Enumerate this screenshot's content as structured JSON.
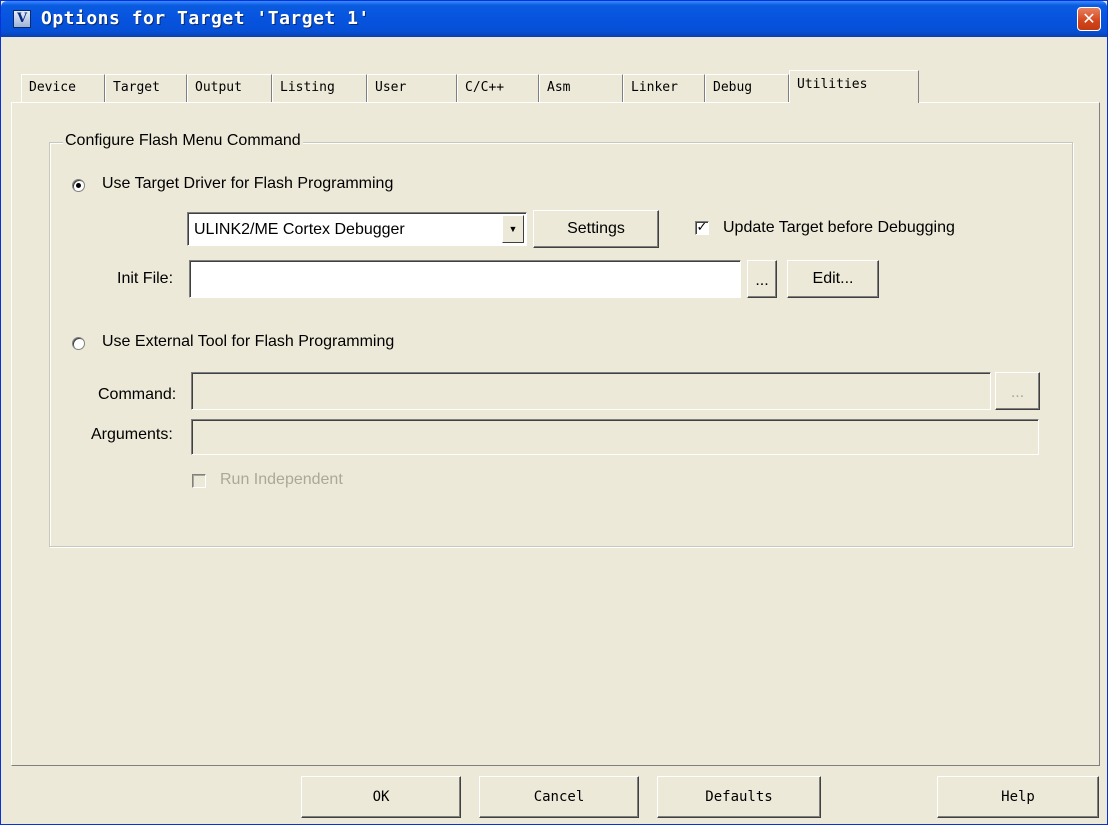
{
  "window": {
    "title": "Options for Target 'Target 1'",
    "app_icon": "V",
    "close_glyph": "✕"
  },
  "tabs": [
    {
      "label": "Device"
    },
    {
      "label": "Target"
    },
    {
      "label": "Output"
    },
    {
      "label": "Listing"
    },
    {
      "label": "User"
    },
    {
      "label": "C/C++"
    },
    {
      "label": "Asm"
    },
    {
      "label": "Linker"
    },
    {
      "label": "Debug"
    },
    {
      "label": "Utilities",
      "active": true
    }
  ],
  "flash_group": {
    "title": "Configure Flash Menu Command",
    "use_target_driver": {
      "label": "Use Target Driver for Flash Programming",
      "selected": true,
      "driver": "ULINK2/ME Cortex Debugger",
      "settings_label": "Settings",
      "update_target_label": "Update Target before Debugging",
      "update_target_checked": true,
      "init_file_label": "Init File:",
      "init_file_value": "",
      "browse_label": "...",
      "edit_label": "Edit..."
    },
    "use_external_tool": {
      "label": "Use External Tool for Flash Programming",
      "selected": false,
      "command_label": "Command:",
      "command_value": "",
      "browse_label": "...",
      "arguments_label": "Arguments:",
      "arguments_value": "",
      "run_independent_label": "Run Independent",
      "run_independent_checked": false
    }
  },
  "footer": {
    "ok": "OK",
    "cancel": "Cancel",
    "defaults": "Defaults",
    "help": "Help"
  },
  "colors": {
    "dialog_bg": "#ece9d8",
    "titlebar": "#0753df",
    "close_button": "#d2451c",
    "disabled_text": "#aca899"
  }
}
